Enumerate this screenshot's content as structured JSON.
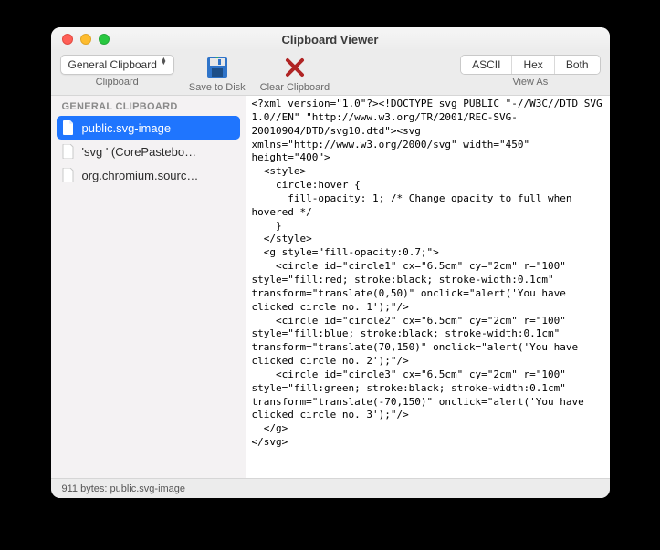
{
  "window": {
    "title": "Clipboard Viewer"
  },
  "toolbar": {
    "clipboard_select": {
      "value": "General Clipboard",
      "label": "Clipboard"
    },
    "save_label": "Save to Disk",
    "clear_label": "Clear Clipboard",
    "viewas_label": "View As",
    "seg": {
      "ascii": "ASCII",
      "hex": "Hex",
      "both": "Both"
    }
  },
  "sidebar": {
    "section": "GENERAL CLIPBOARD",
    "items": [
      {
        "label": "public.svg-image",
        "selected": true
      },
      {
        "label": "'svg ' (CorePastebo…",
        "selected": false
      },
      {
        "label": "org.chromium.sourc…",
        "selected": false
      }
    ]
  },
  "content_text": "<?xml version=\"1.0\"?><!DOCTYPE svg PUBLIC \"-//W3C//DTD SVG 1.0//EN\" \"http://www.w3.org/TR/2001/REC-SVG-20010904/DTD/svg10.dtd\"><svg xmlns=\"http://www.w3.org/2000/svg\" width=\"450\" height=\"400\">\n  <style>\n    circle:hover {\n      fill-opacity: 1; /* Change opacity to full when hovered */\n    }\n  </style>\n  <g style=\"fill-opacity:0.7;\">\n    <circle id=\"circle1\" cx=\"6.5cm\" cy=\"2cm\" r=\"100\" style=\"fill:red; stroke:black; stroke-width:0.1cm\" transform=\"translate(0,50)\" onclick=\"alert('You have clicked circle no. 1');\"/>\n    <circle id=\"circle2\" cx=\"6.5cm\" cy=\"2cm\" r=\"100\" style=\"fill:blue; stroke:black; stroke-width:0.1cm\" transform=\"translate(70,150)\" onclick=\"alert('You have clicked circle no. 2');\"/>\n    <circle id=\"circle3\" cx=\"6.5cm\" cy=\"2cm\" r=\"100\" style=\"fill:green; stroke:black; stroke-width:0.1cm\" transform=\"translate(-70,150)\" onclick=\"alert('You have clicked circle no. 3');\"/>\n  </g>\n</svg>",
  "statusbar": {
    "text": "911 bytes: public.svg-image"
  }
}
